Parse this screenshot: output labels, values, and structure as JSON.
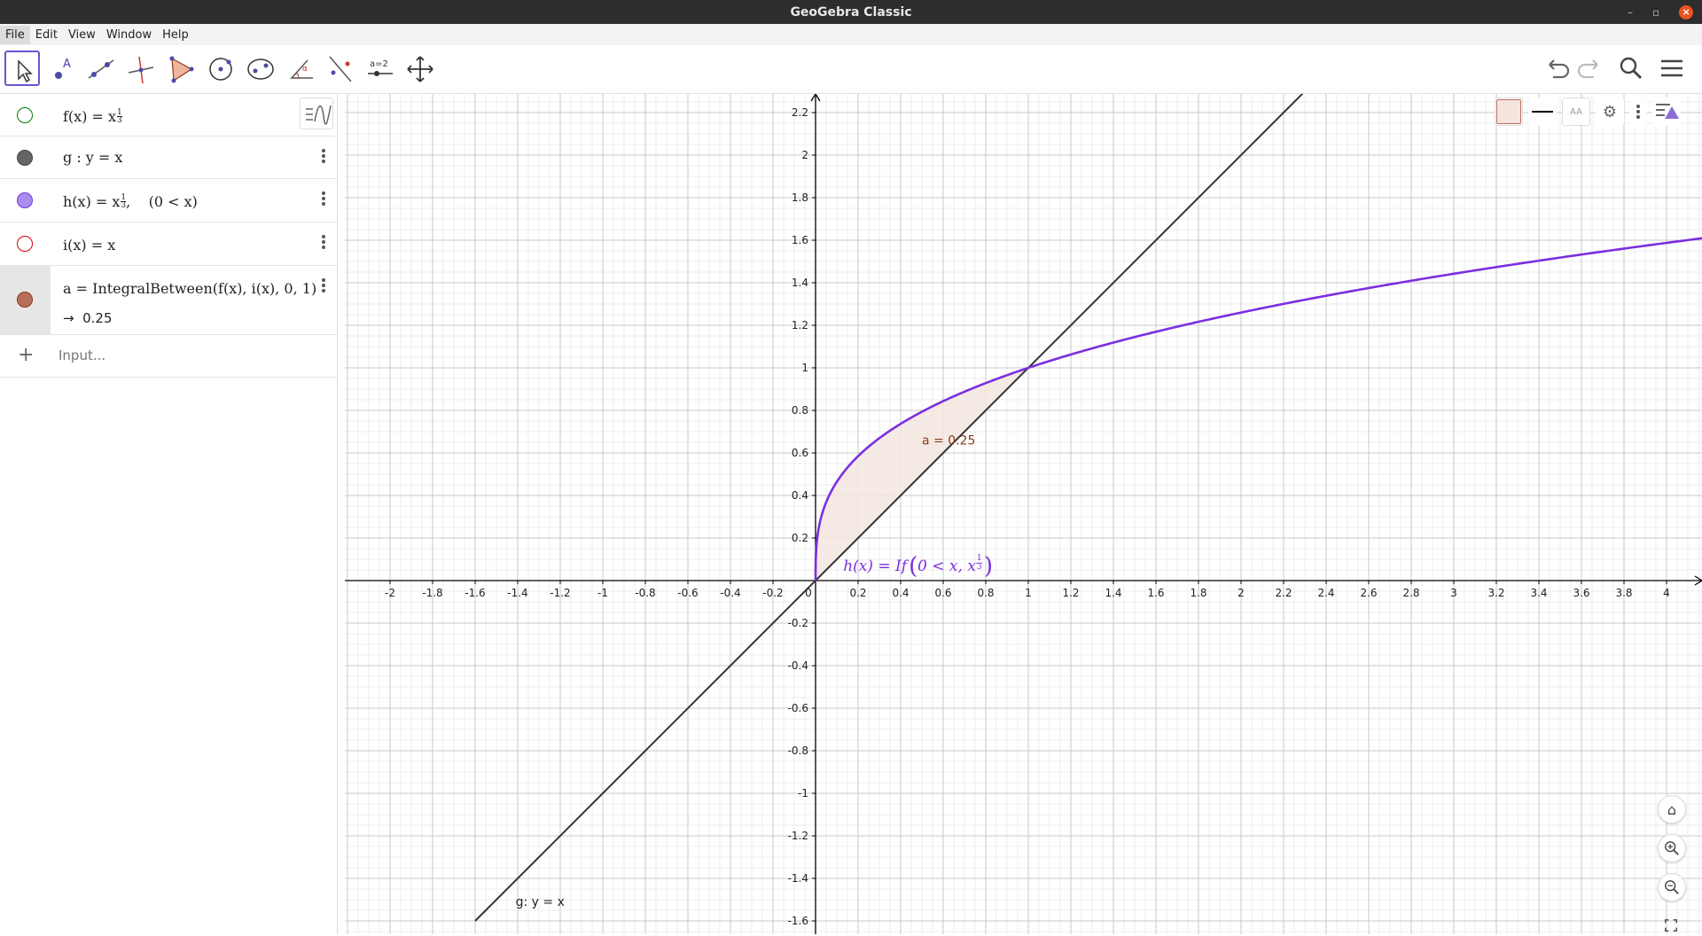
{
  "window": {
    "title": "GeoGebra Classic"
  },
  "menubar": {
    "items": [
      "File",
      "Edit",
      "View",
      "Window",
      "Help"
    ]
  },
  "algebra": {
    "rows": [
      {
        "label": "f(x) = x",
        "exp_num": "1",
        "exp_den": "3",
        "suffix": "",
        "color": "#008000",
        "filled": false
      },
      {
        "label": "g : y = x",
        "color": "#444444",
        "filled": true
      },
      {
        "label": "h(x) = x",
        "exp_num": "1",
        "exp_den": "3",
        "suffix": ",    (0 < x)",
        "color": "#7b2fe0",
        "filled": true
      },
      {
        "label": "i(x) = x",
        "color": "#dd0000",
        "filled": false
      },
      {
        "label": "a = IntegralBetween(f(x), i(x), 0, 1)",
        "result": "→  0.25",
        "color": "#b76e5b",
        "filled": true
      }
    ],
    "input_placeholder": "Input..."
  },
  "graphics": {
    "labels": {
      "area": "a = 0.25",
      "line_g": "g: y = x",
      "h_prefix": "h(x)  =  If",
      "h_args": "0 < x, x",
      "h_exp_num": "1",
      "h_exp_den": "3"
    },
    "x_ticks": [
      "-2",
      "-1.8",
      "-1.6",
      "-1.4",
      "-1.2",
      "-1",
      "-0.8",
      "-0.6",
      "-0.4",
      "-0.2",
      "0",
      "0.2",
      "0.4",
      "0.6",
      "0.8",
      "1",
      "1.2",
      "1.4",
      "1.6",
      "1.8",
      "2",
      "2.2",
      "2.4",
      "2.6",
      "2.8",
      "3",
      "3.2",
      "3.4",
      "3.6",
      "3.8",
      "4"
    ],
    "y_ticks": [
      "2.2",
      "2",
      "1.8",
      "1.6",
      "1.4",
      "1.2",
      "1",
      "0.8",
      "0.6",
      "0.4",
      "0.2",
      "-0.2",
      "-0.4",
      "-0.6",
      "-0.8",
      "-1",
      "-1.2",
      "-1.4",
      "-1.6"
    ],
    "colors": {
      "line": "#333333",
      "curve": "#7b2fe0",
      "area_fill": "#f5e6e1",
      "area_stroke": "#8b3a1a",
      "grid_major": "#c8c8c8",
      "grid_minor": "#ececec",
      "accent": "#6557d2"
    }
  },
  "chart_data": {
    "type": "line",
    "series": [
      {
        "name": "g",
        "x": [
          -1.6,
          2.5
        ],
        "y": [
          -1.6,
          2.5
        ]
      },
      {
        "name": "h",
        "x": [
          0,
          0.001,
          0.008,
          0.027,
          0.064,
          0.125,
          0.216,
          0.343,
          0.512,
          0.729,
          1,
          1.5,
          2,
          2.5,
          3,
          3.5,
          4,
          4.2
        ],
        "y": [
          0,
          0.1,
          0.2,
          0.3,
          0.4,
          0.5,
          0.6,
          0.7,
          0.8,
          0.9,
          1,
          1.1447,
          1.2599,
          1.3572,
          1.4422,
          1.5183,
          1.5874,
          1.6134
        ]
      }
    ],
    "filled_region": {
      "between": [
        "f",
        "i"
      ],
      "from": 0,
      "to": 1,
      "value": 0.25
    },
    "xlim": [
      -2.2,
      4.2
    ],
    "ylim": [
      -1.65,
      2.3
    ],
    "grid": true
  }
}
